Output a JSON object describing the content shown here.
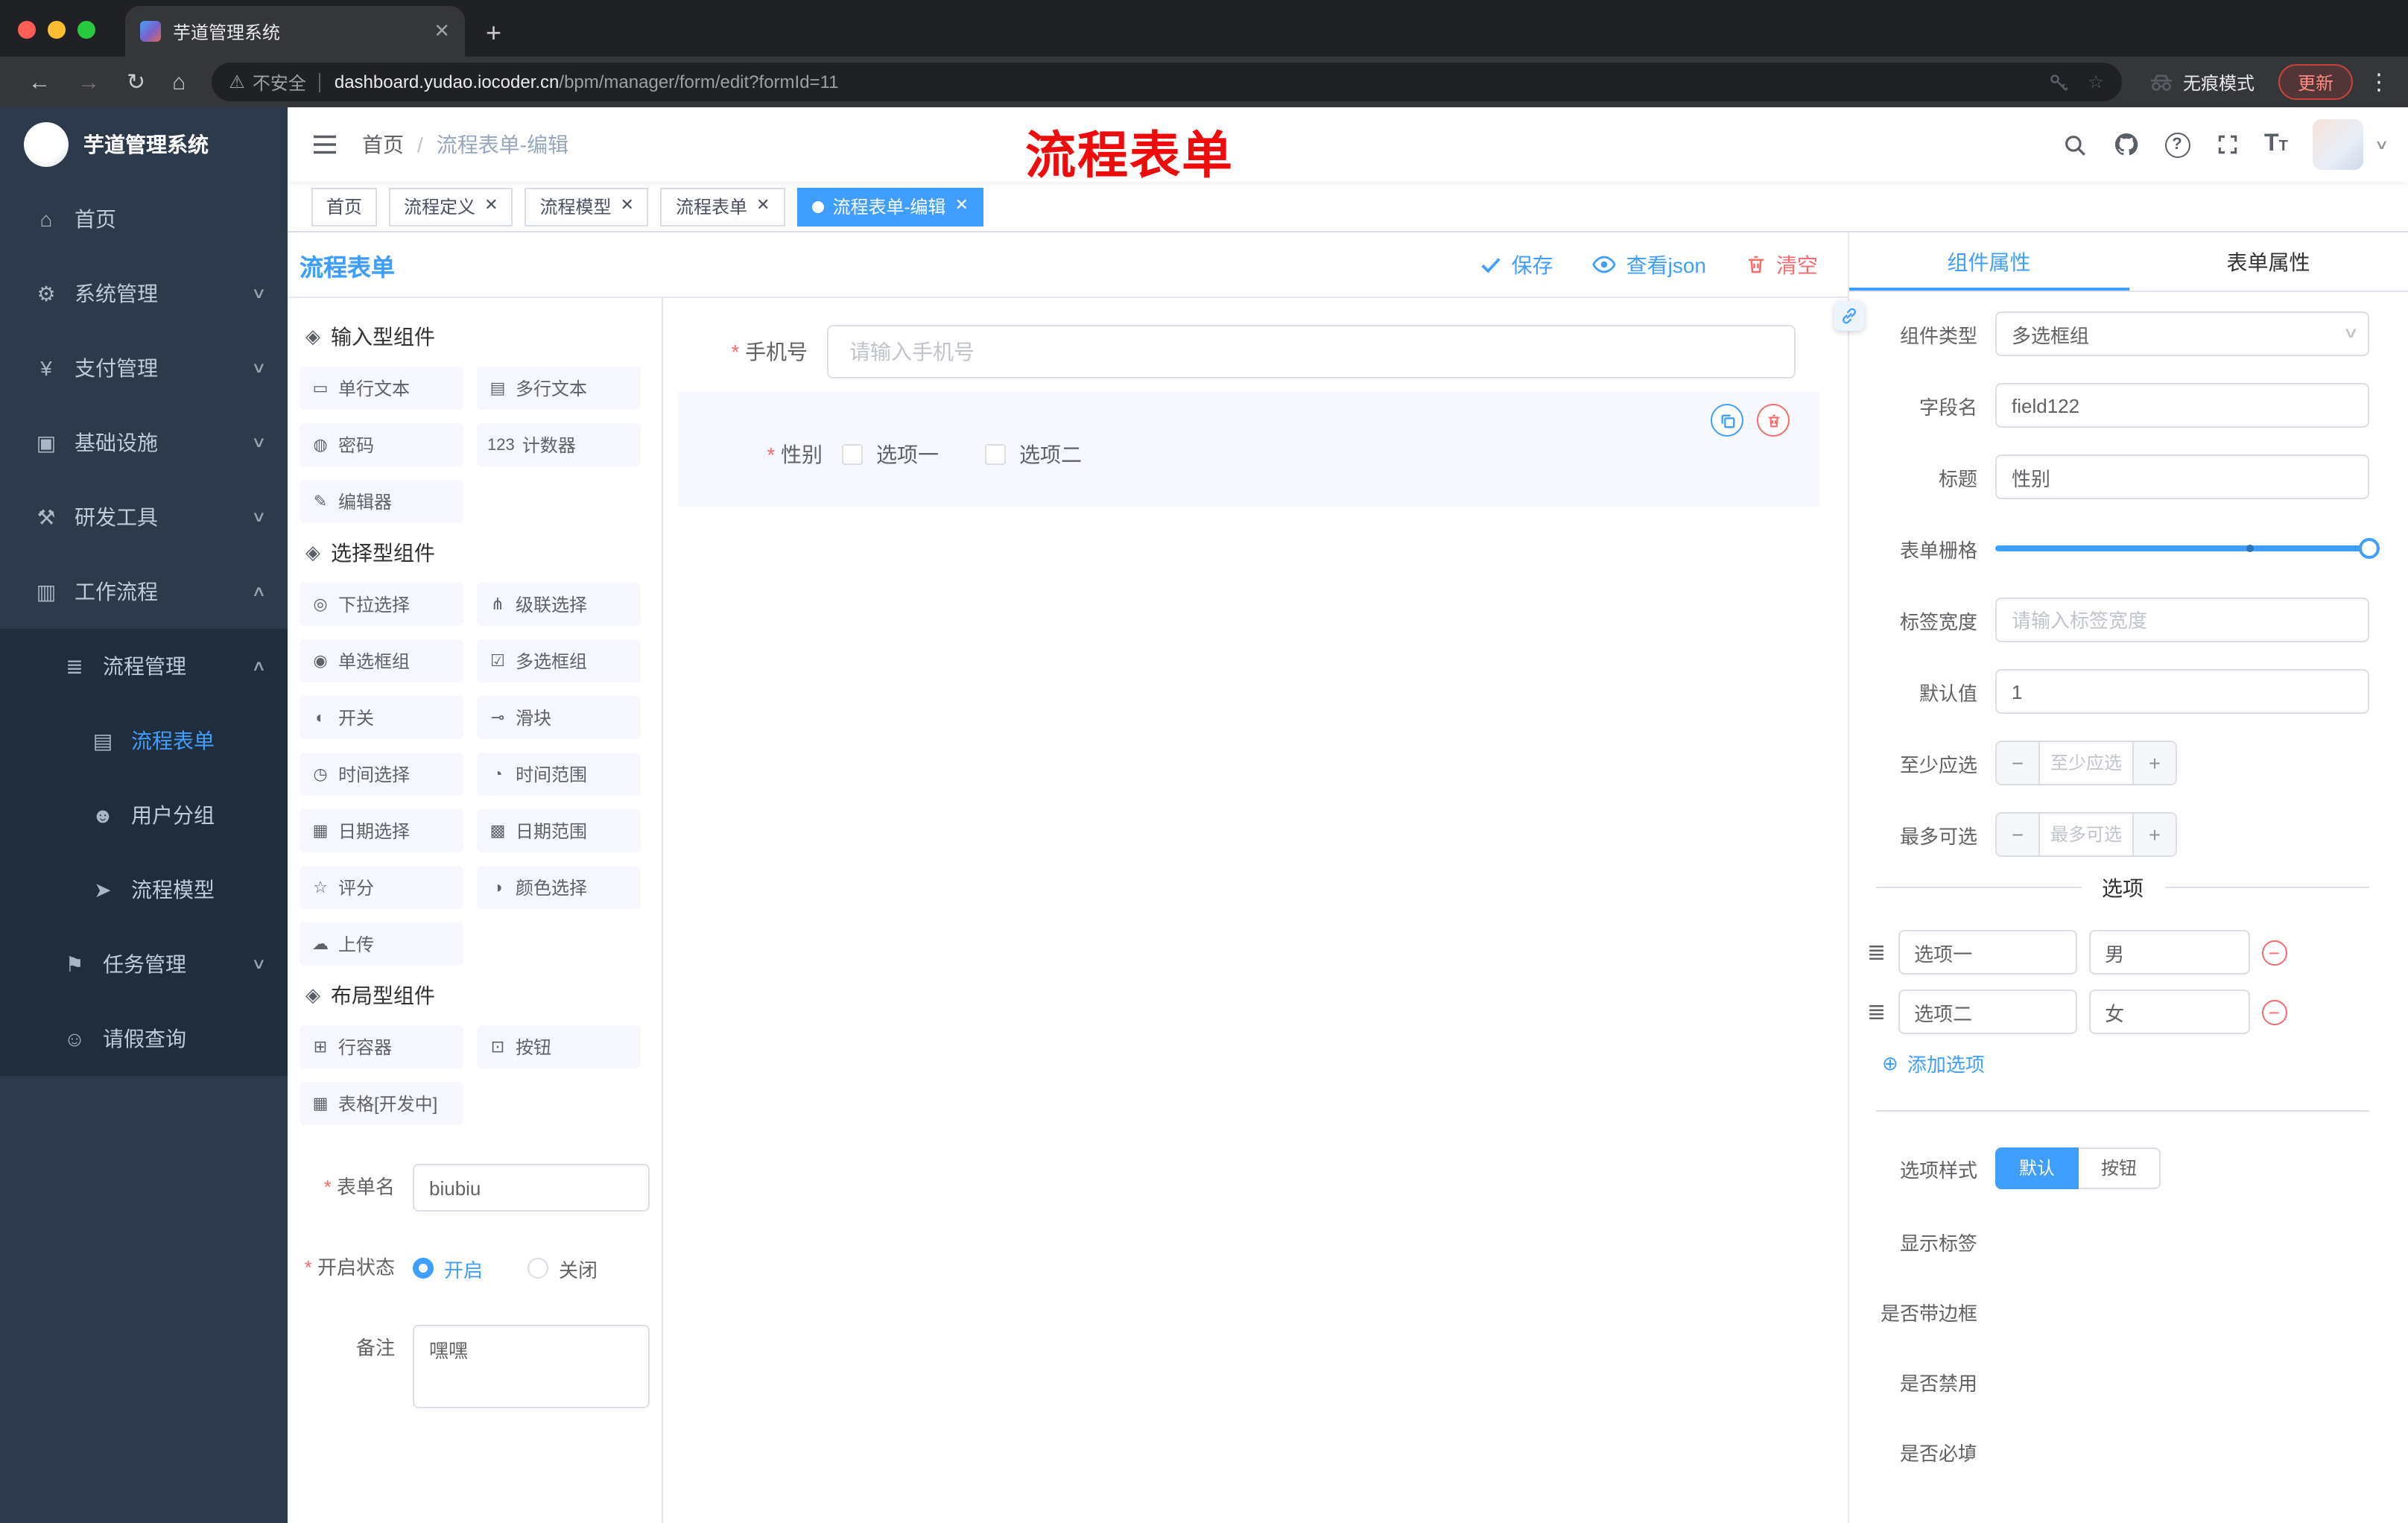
{
  "accent": {
    "primary": "#409eff",
    "danger": "#f56c6c"
  },
  "browser": {
    "tab_title": "芋道管理系统",
    "new_tab": "+",
    "security_label": "不安全",
    "url_host": "dashboard.yudao.iocoder.cn",
    "url_path": "/bpm/manager/form/edit?formId=11",
    "incognito_label": "无痕模式",
    "update_label": "更新"
  },
  "sidebar": {
    "logo_title": "芋道管理系统",
    "items": [
      {
        "icon": "⌂",
        "label": "首页",
        "level": 0
      },
      {
        "icon": "⚙",
        "label": "系统管理",
        "level": 0,
        "chev": "∨"
      },
      {
        "icon": "¥",
        "label": "支付管理",
        "level": 0,
        "chev": "∨"
      },
      {
        "icon": "▣",
        "label": "基础设施",
        "level": 0,
        "chev": "∨"
      },
      {
        "icon": "⚒",
        "label": "研发工具",
        "level": 0,
        "chev": "∨"
      },
      {
        "icon": "▥",
        "label": "工作流程",
        "level": 0,
        "chev": "∧"
      },
      {
        "icon": "≣",
        "label": "流程管理",
        "level": 1,
        "chev": "∧",
        "sub": true
      },
      {
        "icon": "▤",
        "label": "流程表单",
        "level": 2,
        "sub": true,
        "active": true
      },
      {
        "icon": "☻",
        "label": "用户分组",
        "level": 2,
        "sub": true
      },
      {
        "icon": "➤",
        "label": "流程模型",
        "level": 2,
        "sub": true
      },
      {
        "icon": "⚑",
        "label": "任务管理",
        "level": 1,
        "chev": "∨",
        "sub": true
      },
      {
        "icon": "☺",
        "label": "请假查询",
        "level": 1,
        "sub": true
      }
    ]
  },
  "header": {
    "breadcrumb_root": "首页",
    "breadcrumb_sep": "/",
    "breadcrumb_current": "流程表单-编辑",
    "overlay_title": "流程表单"
  },
  "tags": [
    {
      "label": "首页"
    },
    {
      "label": "流程定义",
      "closable": true
    },
    {
      "label": "流程模型",
      "closable": true
    },
    {
      "label": "流程表单",
      "closable": true
    },
    {
      "label": "流程表单-编辑",
      "closable": true,
      "active": true
    }
  ],
  "designer": {
    "title": "流程表单",
    "save_label": "保存",
    "view_json_label": "查看json",
    "clear_label": "清空",
    "palette_groups": [
      {
        "title": "输入型组件",
        "items": [
          {
            "icon": "▭",
            "label": "单行文本"
          },
          {
            "icon": "▤",
            "label": "多行文本"
          },
          {
            "icon": "◍",
            "label": "密码"
          },
          {
            "icon": "123",
            "label": "计数器"
          },
          {
            "icon": "✎",
            "label": "编辑器"
          }
        ]
      },
      {
        "title": "选择型组件",
        "items": [
          {
            "icon": "◎",
            "label": "下拉选择"
          },
          {
            "icon": "⋔",
            "label": "级联选择"
          },
          {
            "icon": "◉",
            "label": "单选框组"
          },
          {
            "icon": "☑",
            "label": "多选框组"
          },
          {
            "icon": "◐",
            "label": "开关"
          },
          {
            "icon": "⊸",
            "label": "滑块"
          },
          {
            "icon": "◷",
            "label": "时间选择"
          },
          {
            "icon": "◔",
            "label": "时间范围"
          },
          {
            "icon": "▦",
            "label": "日期选择"
          },
          {
            "icon": "▩",
            "label": "日期范围"
          },
          {
            "icon": "☆",
            "label": "评分"
          },
          {
            "icon": "◑",
            "label": "颜色选择"
          },
          {
            "icon": "☁",
            "label": "上传"
          }
        ]
      },
      {
        "title": "布局型组件",
        "items": [
          {
            "icon": "⊞",
            "label": "行容器"
          },
          {
            "icon": "⊡",
            "label": "按钮"
          },
          {
            "icon": "▦",
            "label": "表格[开发中]"
          }
        ]
      }
    ],
    "meta_form": {
      "name_label": "表单名",
      "name_value": "biubiu",
      "status_label": "开启状态",
      "status_on": "开启",
      "status_off": "关闭",
      "remark_label": "备注",
      "remark_value": "嘿嘿"
    },
    "canvas": {
      "phone_label": "手机号",
      "phone_placeholder": "请输入手机号",
      "gender_label": "性别",
      "gender_options": [
        "选项一",
        "选项二"
      ]
    },
    "props": {
      "tab_component": "组件属性",
      "tab_form": "表单属性",
      "rows": {
        "type_label": "组件类型",
        "type_value": "多选框组",
        "field_label": "字段名",
        "field_value": "field122",
        "title_label": "标题",
        "title_value": "性别",
        "grid_label": "表单栅格",
        "width_label": "标签宽度",
        "width_placeholder": "请输入标签宽度",
        "default_label": "默认值",
        "default_value": "1",
        "min_label": "至少应选",
        "min_placeholder": "至少应选",
        "max_label": "最多可选",
        "max_placeholder": "最多可选"
      },
      "options_title": "选项",
      "options": [
        {
          "label": "选项一",
          "value": "男"
        },
        {
          "label": "选项二",
          "value": "女"
        }
      ],
      "add_option_label": "添加选项",
      "style_label": "选项样式",
      "style_default": "默认",
      "style_button": "按钮",
      "switches": [
        {
          "label": "显示标签",
          "on": true
        },
        {
          "label": "是否带边框",
          "on": false
        },
        {
          "label": "是否禁用",
          "on": false
        },
        {
          "label": "是否必填",
          "on": true
        }
      ]
    }
  }
}
